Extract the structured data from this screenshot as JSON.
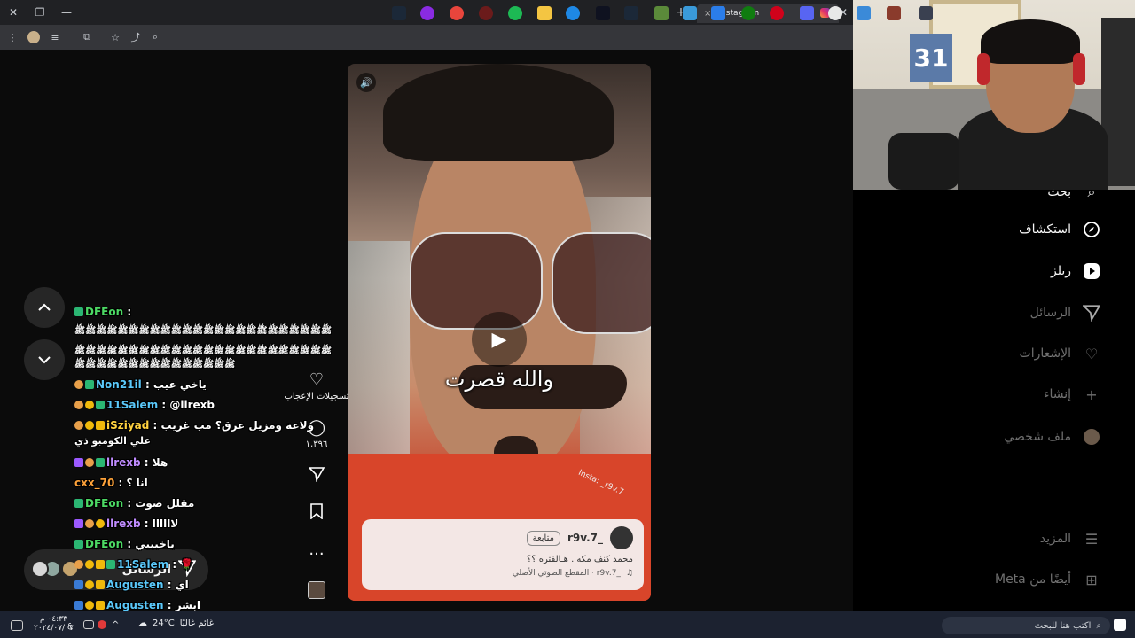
{
  "browser": {
    "tab_title": "Instagram",
    "close_tab": "×",
    "new_tab": "+",
    "window_close": "✕",
    "window_restore": "❐",
    "window_min": "—"
  },
  "reel": {
    "caption_overlay": "والله قصرت",
    "watermark": "Insta: _r9v.7",
    "username": "_r9v.7",
    "follow_label": "متابعة",
    "description": "محمد كنف مكه . هـالفتره ؟؟",
    "audio": "_r9v.7 · المقطع الصوتي الأصلي"
  },
  "rail": {
    "likes_label": "تسجيلات الإعجاب",
    "comments_count": "١,٣٩٦",
    "more": "..."
  },
  "messages_pill": {
    "label": "الرسائل"
  },
  "ig_sidebar": {
    "items": [
      {
        "label": "بحث",
        "icon": "search-icon"
      },
      {
        "label": "استكشاف",
        "icon": "compass-icon"
      },
      {
        "label": "ريلز",
        "icon": "reels-icon"
      },
      {
        "label": "الرسائل",
        "icon": "send-icon"
      },
      {
        "label": "الإشعارات",
        "icon": "heart-icon"
      },
      {
        "label": "إنشاء",
        "icon": "plus-icon"
      },
      {
        "label": "ملف شخصي",
        "icon": "profile-icon"
      },
      {
        "label": "المزيد",
        "icon": "menu-icon"
      },
      {
        "label": "أيضًا من Meta",
        "icon": "grid-icon"
      }
    ]
  },
  "webcam": {
    "poster_number": "31"
  },
  "chat": {
    "messages": [
      {
        "user": "DFEon",
        "text": "",
        "color": "green"
      },
      {
        "user": "",
        "text": "ﷺﷺﷺﷺﷺﷺﷺﷺﷺﷺﷺﷺﷺﷺﷺﷺﷺﷺﷺﷺﷺﷺﷺﷺ",
        "color": "white"
      },
      {
        "user": "",
        "text": "ﷺﷺﷺﷺﷺﷺﷺﷺﷺﷺﷺﷺﷺﷺﷺﷺﷺﷺﷺﷺﷺﷺﷺﷺ",
        "color": "white"
      },
      {
        "user": "",
        "text": "ﷺﷺﷺﷺﷺﷺﷺﷺﷺﷺﷺﷺﷺﷺﷺ",
        "color": "white"
      },
      {
        "user": "Non21il",
        "text": "ياخي عيب",
        "color": "blue"
      },
      {
        "user": "11Salem",
        "text": "@llrexb",
        "color": "blue"
      },
      {
        "user": "iSziyad",
        "text": "ولاعة ومزيل عرق؟ مب غريب",
        "color": "yellow"
      },
      {
        "user": "",
        "text": "علي الكومبو ذي",
        "color": "white"
      },
      {
        "user": "llrexb",
        "text": "هلا",
        "color": "purple"
      },
      {
        "user": "cxx_70",
        "text": "انا ؟",
        "color": "orange"
      },
      {
        "user": "DFEon",
        "text": "مقلل صوت",
        "color": "green"
      },
      {
        "user": "llrexb",
        "text": "لاااااا",
        "color": "purple"
      },
      {
        "user": "DFEon",
        "text": "ياخيييي",
        "color": "green"
      },
      {
        "user": "11Salem",
        "text": "🌹",
        "color": "blue"
      },
      {
        "user": "Augusten",
        "text": "اي",
        "color": "blue"
      },
      {
        "user": "Augusten",
        "text": "ابشر",
        "color": "blue"
      }
    ]
  },
  "taskbar": {
    "search_placeholder": "اكتب هنا للبحث",
    "temperature": "24°C",
    "weather_desc": "غائم غالبًا",
    "time": "٠٤:٣٣ م",
    "date": "٢٠٢٤/٠٧/٠٧",
    "lang": "ع"
  },
  "colors": {
    "page_bg": "#000000",
    "chrome_bg": "#202124",
    "pill_bg": "#262626",
    "taskbar_bg": "#1c2230"
  }
}
